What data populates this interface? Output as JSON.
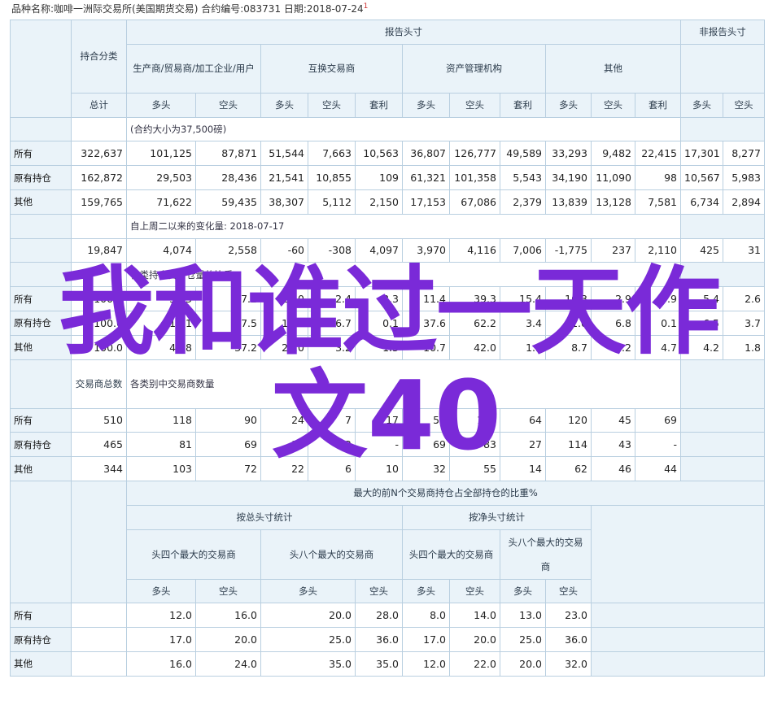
{
  "header": {
    "text": "品种名称:咖啡一洲际交易所(美国期货交易)  合约编号:083731  日期:2018-07-24",
    "mark": "1"
  },
  "head": {
    "report": "报告头寸",
    "nonreport": "非报告头寸",
    "pos_class": "持合分类",
    "producer": "生产商/贸易商/加工企业/用户",
    "swap": "互换交易商",
    "asset": "资产管理机构",
    "other": "其他",
    "total": "总计",
    "long": "多头",
    "short": "空头",
    "spread": "套利"
  },
  "sec1": {
    "note": "(合约大小为37,500磅)",
    "rows": [
      {
        "label": "所有",
        "cells": [
          "322,637",
          "101,125",
          "87,871",
          "51,544",
          "7,663",
          "10,563",
          "36,807",
          "126,777",
          "49,589",
          "33,293",
          "9,482",
          "22,415",
          "17,301",
          "8,277"
        ]
      },
      {
        "label": "原有持仓",
        "cells": [
          "162,872",
          "29,503",
          "28,436",
          "21,541",
          "10,855",
          "109",
          "61,321",
          "101,358",
          "5,543",
          "34,190",
          "11,090",
          "98",
          "10,567",
          "5,983"
        ]
      },
      {
        "label": "其他",
        "cells": [
          "159,765",
          "71,622",
          "59,435",
          "38,307",
          "5,112",
          "2,150",
          "17,153",
          "67,086",
          "2,379",
          "13,839",
          "13,128",
          "7,581",
          "6,734",
          "2,894"
        ]
      }
    ]
  },
  "sec2": {
    "note": "自上周二以来的变化量: 2018-07-17",
    "cells": [
      "19,847",
      "4,074",
      "2,558",
      "-60",
      "-308",
      "4,097",
      "3,970",
      "4,116",
      "7,006",
      "-1,775",
      "237",
      "2,110",
      "425",
      "31"
    ]
  },
  "sec3": {
    "note": "各类持仓占持仓量的比重",
    "rows": [
      {
        "label": "所有",
        "cells": [
          "100.0",
          "31.3",
          "27.2",
          "16.0",
          "2.4",
          "3.3",
          "11.4",
          "39.3",
          "15.4",
          "10.3",
          "2.9",
          "6.9",
          "5.4",
          "2.6"
        ]
      },
      {
        "label": "原有持仓",
        "cells": [
          "100.0",
          "18.1",
          "17.5",
          "13.2",
          "6.7",
          "0.1",
          "37.6",
          "62.2",
          "3.4",
          "21.0",
          "6.8",
          "0.1",
          "6.5",
          "3.7"
        ]
      },
      {
        "label": "其他",
        "cells": [
          "100.0",
          "44.8",
          "37.2",
          "24.0",
          "3.2",
          "1.3",
          "10.7",
          "42.0",
          "1.5",
          "8.7",
          "8.2",
          "4.7",
          "4.2",
          "1.8"
        ]
      }
    ]
  },
  "sec4": {
    "label": "交易商总数",
    "note": "各类别中交易商数量",
    "rows": [
      {
        "label": "所有",
        "cells": [
          "510",
          "118",
          "90",
          "24",
          "7",
          "17",
          "51",
          "101",
          "64",
          "120",
          "45",
          "69"
        ]
      },
      {
        "label": "原有持仓",
        "cells": [
          "465",
          "81",
          "69",
          "17",
          "12",
          "-",
          "69",
          "83",
          "27",
          "114",
          "43",
          "-"
        ]
      },
      {
        "label": "其他",
        "cells": [
          "344",
          "103",
          "72",
          "22",
          "6",
          "10",
          "32",
          "55",
          "14",
          "62",
          "46",
          "44"
        ]
      }
    ]
  },
  "sec5": {
    "title": "最大的前N个交易商持仓占全部持仓的比重%",
    "gross": "按总头寸统计",
    "net": "按净头寸统计",
    "top4": "头四个最大的交易商",
    "top8": "头八个最大的交易商",
    "rows": [
      {
        "label": "所有",
        "cells": [
          "12.0",
          "16.0",
          "20.0",
          "28.0",
          "8.0",
          "14.0",
          "13.0",
          "23.0"
        ]
      },
      {
        "label": "原有持仓",
        "cells": [
          "17.0",
          "20.0",
          "25.0",
          "36.0",
          "17.0",
          "20.0",
          "25.0",
          "36.0"
        ]
      },
      {
        "label": "其他",
        "cells": [
          "16.0",
          "24.0",
          "35.0",
          "35.0",
          "12.0",
          "22.0",
          "20.0",
          "32.0"
        ]
      }
    ]
  },
  "overlay": {
    "line1": "我和谁过一天作",
    "line2": "文40"
  }
}
